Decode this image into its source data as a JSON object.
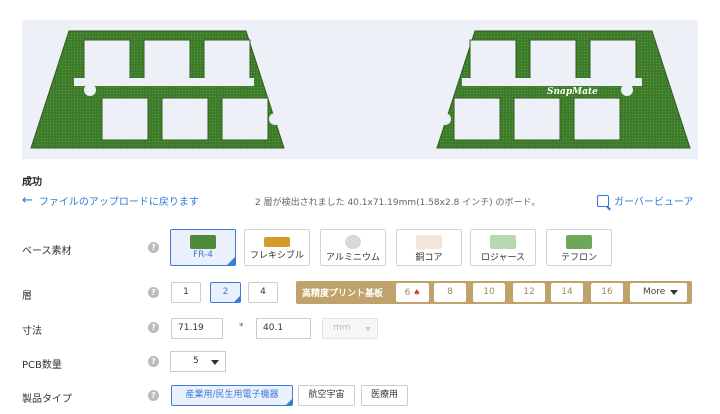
{
  "preview": {
    "board_text": "SnapMate"
  },
  "status": "成功",
  "back_link": "ファイルのアップロードに戻ります",
  "detect_info": "2 層が検出されました 40.1x71.19mm(1.58x2.8 インチ) のボード。",
  "gerber_viewer": "ガーバービューア",
  "help_icon": "?",
  "base_material": {
    "label": "ベース素材",
    "options": [
      "FR-4",
      "フレキシブル",
      "アルミニウム",
      "銅コア",
      "ロジャース",
      "テフロン"
    ],
    "selected": "FR-4"
  },
  "layers": {
    "label": "層",
    "options": [
      "1",
      "2",
      "4"
    ],
    "selected": "2",
    "hp_title": "高精度プリント基板",
    "hp_options": [
      "6",
      "8",
      "10",
      "12",
      "14",
      "16"
    ],
    "more": "More"
  },
  "dimensions": {
    "label": "寸法",
    "length": "71.19",
    "times": "*",
    "width": "40.1",
    "unit": "mm"
  },
  "pcb_qty": {
    "label": "PCB数量",
    "value": "5"
  },
  "product_type": {
    "label": "製品タイプ",
    "options": [
      "産業用/民生用電子機器",
      "航空宇宙",
      "医療用"
    ],
    "selected": "産業用/民生用電子機器"
  },
  "colors": {
    "accent": "#3d7bd6",
    "link": "#2e7bd6",
    "board_green": "#3d7a2a",
    "hp_gold": "#bfa36a"
  }
}
